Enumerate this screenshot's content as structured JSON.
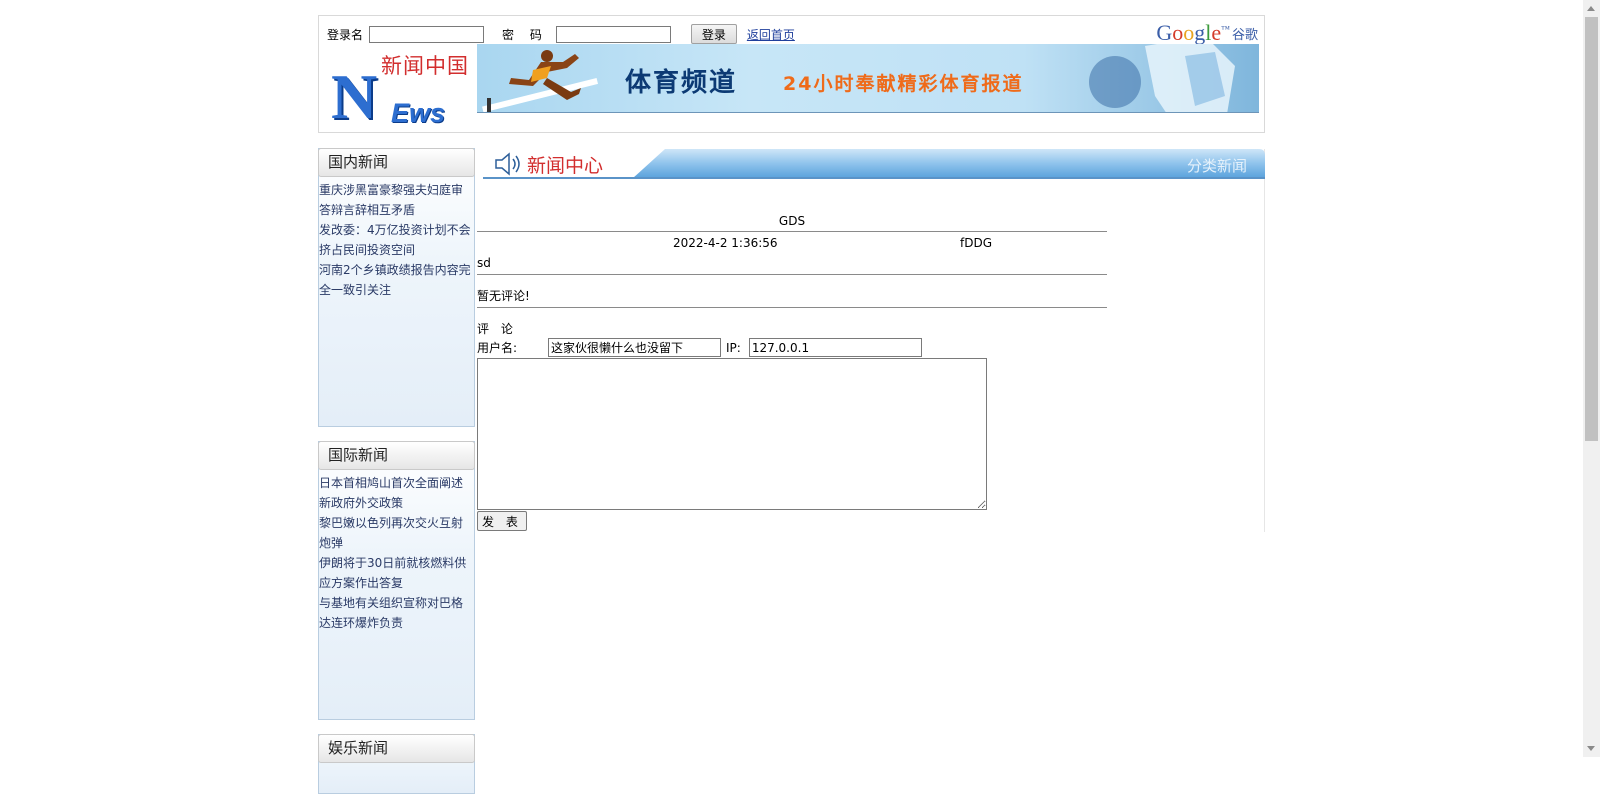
{
  "login": {
    "username_label": "登录名",
    "password_label": "密 码",
    "username_value": "",
    "password_value": "",
    "login_button": "登录",
    "home_link": "返回首页"
  },
  "google": {
    "letters": [
      "G",
      "o",
      "o",
      "g",
      "l",
      "e"
    ],
    "tm": "™",
    "cn": "谷歌"
  },
  "logo": {
    "cn_title": "新闻中国",
    "big_letter": "N",
    "rest": "Ews"
  },
  "banner": {
    "title": "体育频道",
    "subtitle": "24小时奉献精彩体育报道"
  },
  "sidebar": [
    {
      "heading": "国内新闻",
      "items": [
        "重庆涉黑富豪黎强夫妇庭审答辩言辞相互矛盾",
        "发改委：4万亿投资计划不会挤占民间投资空间",
        "河南2个乡镇政绩报告内容完全一致引关注"
      ]
    },
    {
      "heading": "国际新闻",
      "items": [
        "日本首相鸠山首次全面阐述新政府外交政策",
        "黎巴嫩以色列再次交火互射炮弹",
        "伊朗将于30日前就核燃料供应方案作出答复",
        "与基地有关组织宣称对巴格达连环爆炸负责"
      ]
    },
    {
      "heading": "娱乐新闻",
      "items": []
    }
  ],
  "main": {
    "title": "新闻中心",
    "category": "分类新闻"
  },
  "article": {
    "title": "GDS",
    "date": "2022-4-2 1:36:56",
    "author": "fDDG",
    "body": "sd",
    "no_comment": "暂无评论!"
  },
  "comment_form": {
    "heading": "评 论",
    "username_label": "用户名:",
    "username_value": "这家伙很懒什么也没留下",
    "ip_label": "IP:",
    "ip_value": "127.0.0.1",
    "content_value": "",
    "submit_label": "发 表"
  },
  "colors": {
    "accent_red": "#d22e2e",
    "banner_blue": "#0c3a74",
    "banner_orange": "#ef6b1a",
    "link_blue": "#1f3f9c",
    "sidebar_text": "#2a3a66"
  }
}
